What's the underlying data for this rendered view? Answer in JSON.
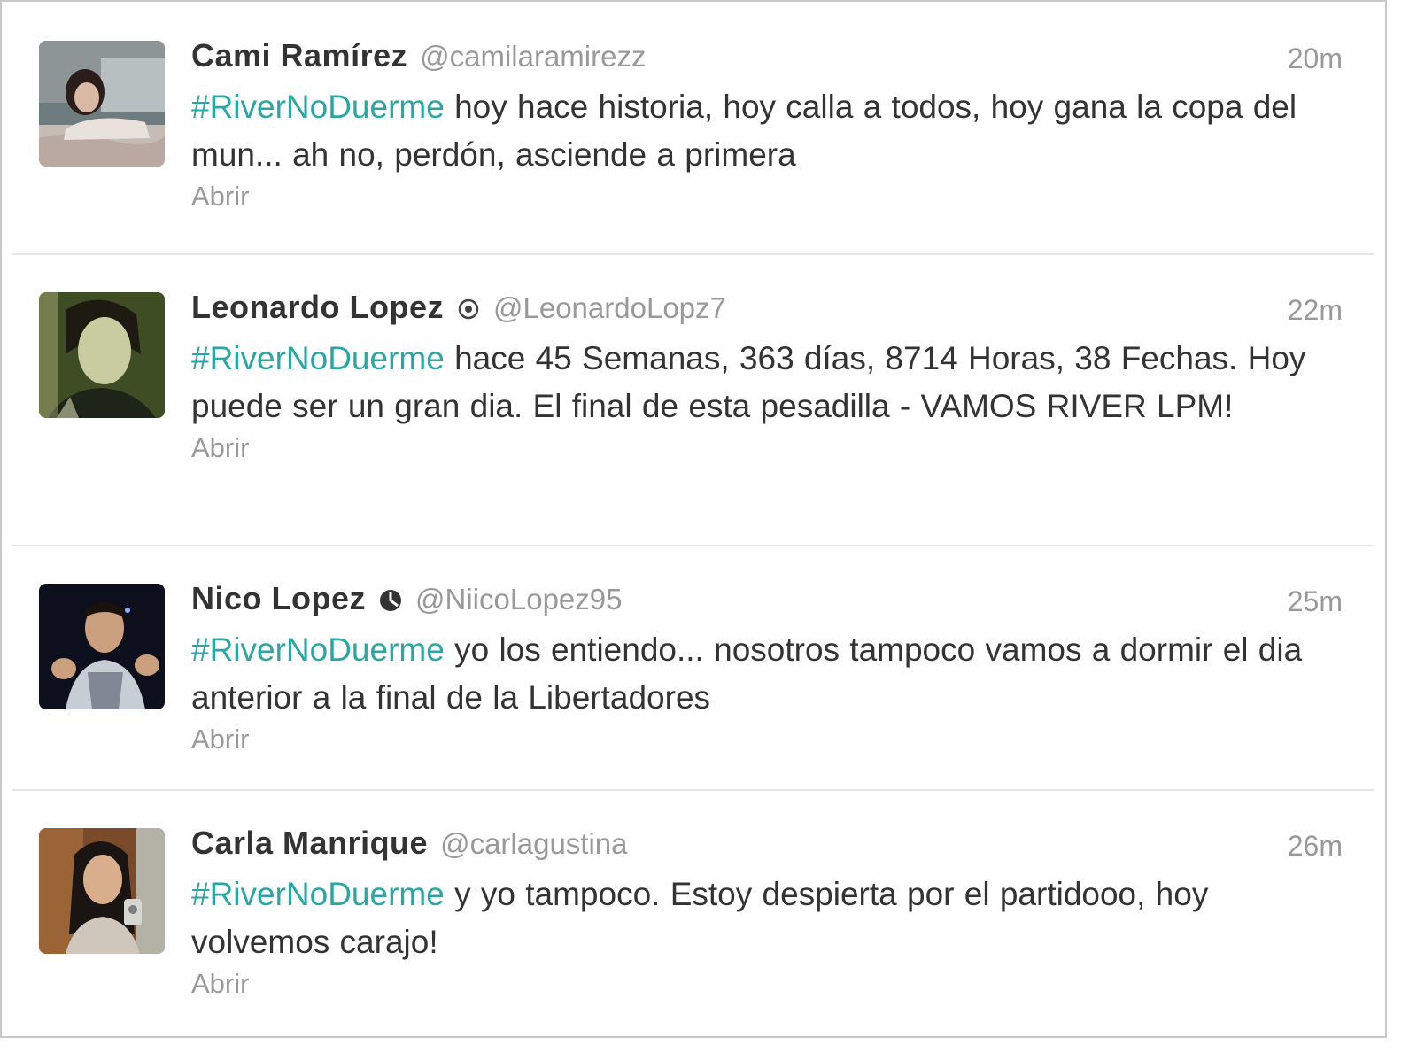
{
  "timeline": {
    "tweets": [
      {
        "name": "Cami Ramírez",
        "handle": "@camilaramirezz",
        "time": "20m",
        "hashtag": "#RiverNoDuerme",
        "text": " hoy hace historia, hoy calla a todos, hoy gana la copa del mun... ah no, perdón, asciende a primera",
        "open_label": "Abrir",
        "avatar_icon": "profile-photo-woman"
      },
      {
        "name": "Leonardo Lopez",
        "handle": "@LeonardoLopz7",
        "time": "22m",
        "hashtag": "#RiverNoDuerme",
        "text": " hace 45 Semanas, 363 días, 8714 Horas, 38 Fechas. Hoy puede ser un gran dia. El final de esta pesadilla - VAMOS RIVER LPM!",
        "open_label": "Abrir",
        "badge_icon": "target-icon",
        "avatar_icon": "profile-photo-man"
      },
      {
        "name": "Nico Lopez",
        "handle": "@NiicoLopez95",
        "time": "25m",
        "hashtag": "#RiverNoDuerme",
        "text": " yo los entiendo... nosotros tampoco vamos a dormir el dia anterior a la final de la Libertadores",
        "open_label": "Abrir",
        "badge_icon": "ball-icon",
        "avatar_icon": "profile-photo-man-thumbs-up"
      },
      {
        "name": "Carla Manrique",
        "handle": "@carlagustina",
        "time": "26m",
        "hashtag": "#RiverNoDuerme",
        "text": " y yo tampoco. Estoy despierta por el partidooo, hoy volvemos carajo!",
        "open_label": "Abrir",
        "avatar_icon": "profile-photo-woman-selfie"
      }
    ]
  },
  "colors": {
    "hashtag": "#2aa6a5",
    "name": "#333333",
    "meta": "#999999",
    "divider": "#e6e6e6",
    "frame_border": "#c8c8c8"
  }
}
